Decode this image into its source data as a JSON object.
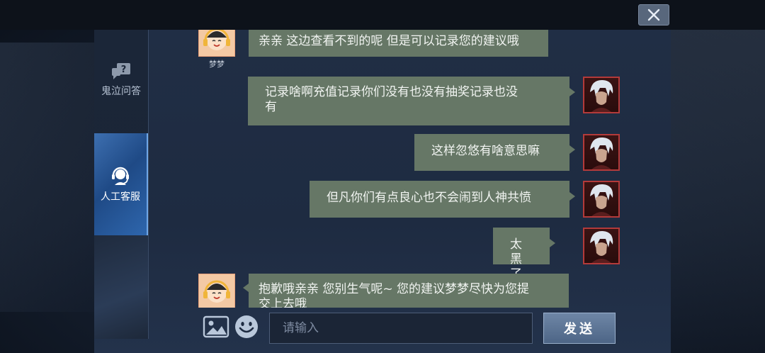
{
  "window": {
    "close_label": "×"
  },
  "sidebar": {
    "items": [
      {
        "label": "鬼泣问答",
        "icon": "question-bubble-icon",
        "active": false
      },
      {
        "label": "人工客服",
        "icon": "headset-agent-icon",
        "active": true
      }
    ]
  },
  "agent": {
    "name": "梦梦"
  },
  "messages": [
    {
      "from": "agent",
      "text": "亲亲 这边查看不到的呢 但是可以记录您的建议哦"
    },
    {
      "from": "user",
      "line1": "记录啥啊充值记录你们没有也没有抽奖记录也没",
      "line2": "有"
    },
    {
      "from": "user",
      "text": "这样忽悠有啥意思嘛"
    },
    {
      "from": "user",
      "text": "但凡你们有点良心也不会闹到人神共愤"
    },
    {
      "from": "user",
      "text": "太黑了"
    },
    {
      "from": "agent",
      "line1": "抱歉哦亲亲 您别生气呢~ 您的建议梦梦尽快为您提",
      "line2": "交上去哦"
    }
  ],
  "input": {
    "placeholder": "请输入",
    "value": ""
  },
  "send_button": {
    "label": "发送"
  },
  "colors": {
    "bubble": "#667766",
    "panel": "#1e2b41",
    "accent": "#3d6fb0"
  }
}
